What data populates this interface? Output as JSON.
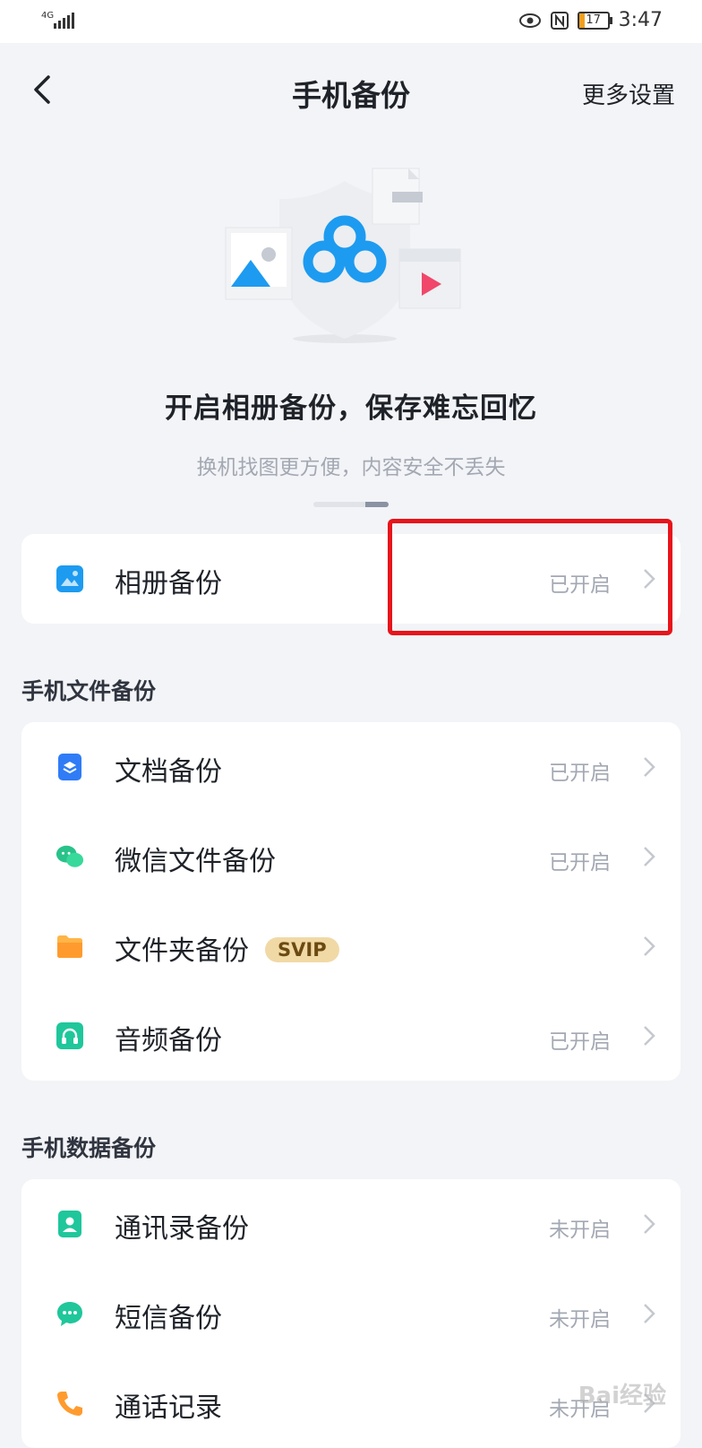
{
  "status_bar": {
    "network": "4G",
    "time": "3:47",
    "battery": "17"
  },
  "header": {
    "title": "手机备份",
    "more_settings": "更多设置"
  },
  "hero": {
    "title": "开启相册备份，保存难忘回忆",
    "subtitle": "换机找图更方便，内容安全不丢失"
  },
  "album": {
    "label": "相册备份",
    "status": "已开启"
  },
  "file_section": {
    "title": "手机文件备份",
    "items": [
      {
        "label": "文档备份",
        "status": "已开启"
      },
      {
        "label": "微信文件备份",
        "status": "已开启"
      },
      {
        "label": "文件夹备份",
        "badge": "SVIP",
        "status": ""
      },
      {
        "label": "音频备份",
        "status": "已开启"
      }
    ]
  },
  "data_section": {
    "title": "手机数据备份",
    "items": [
      {
        "label": "通讯录备份",
        "status": "未开启"
      },
      {
        "label": "短信备份",
        "status": "未开启"
      },
      {
        "label": "通话记录",
        "status": "未开启"
      }
    ]
  },
  "watermark": "Bai经验",
  "colors": {
    "accent": "#1d9bf0",
    "highlight": "#e8141b",
    "svip_bg": "#f1d9a6"
  }
}
